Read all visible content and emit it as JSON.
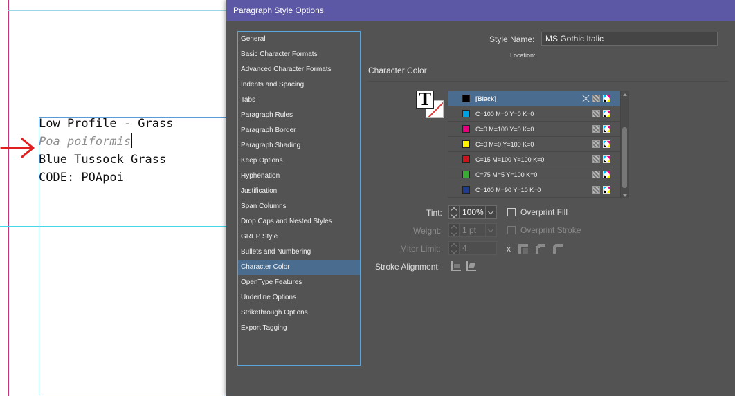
{
  "document": {
    "lines": [
      "Low Profile - Grass",
      "Poa poiformis",
      "Blue Tussock Grass",
      "CODE: POApoi"
    ]
  },
  "dialog": {
    "title": "Paragraph Style Options",
    "nav": {
      "selected": "Character Color",
      "items": [
        "General",
        "Basic Character Formats",
        "Advanced Character Formats",
        "Indents and Spacing",
        "Tabs",
        "Paragraph Rules",
        "Paragraph Border",
        "Paragraph Shading",
        "Keep Options",
        "Hyphenation",
        "Justification",
        "Span Columns",
        "Drop Caps and Nested Styles",
        "GREP Style",
        "Bullets and Numbering",
        "Character Color",
        "OpenType Features",
        "Underline Options",
        "Strikethrough Options",
        "Export Tagging"
      ]
    },
    "style_name_label": "Style Name:",
    "style_name_value": "MS Gothic Italic",
    "location_label": "Location:",
    "section_title": "Character Color",
    "fill_stroke_glyph": "T",
    "swatches": [
      {
        "name": "[Black]",
        "color": "#000000",
        "selected": true
      },
      {
        "name": "C=100 M=0 Y=0 K=0",
        "color": "#00a0e3",
        "selected": false
      },
      {
        "name": "C=0 M=100 Y=0 K=0",
        "color": "#e4007f",
        "selected": false
      },
      {
        "name": "C=0 M=0 Y=100 K=0",
        "color": "#fff100",
        "selected": false
      },
      {
        "name": "C=15 M=100 Y=100 K=0",
        "color": "#c8161e",
        "selected": false
      },
      {
        "name": "C=75 M=5 Y=100 K=0",
        "color": "#3aa935",
        "selected": false
      },
      {
        "name": "C=100 M=90 Y=10 K=0",
        "color": "#1f3b8c",
        "selected": false
      }
    ],
    "tint_label": "Tint:",
    "tint_value": "100%",
    "overprint_fill_label": "Overprint Fill",
    "weight_label": "Weight:",
    "weight_value": "1 pt",
    "overprint_stroke_label": "Overprint Stroke",
    "miter_limit_label": "Miter Limit:",
    "miter_limit_value": "4",
    "miter_x": "x",
    "stroke_alignment_label": "Stroke Alignment:"
  },
  "colors": {
    "titlebar": "#5c58a6",
    "dialog_bg": "#535353",
    "nav_selected": "#4a6d8f",
    "focus_border": "#58a6dc",
    "annotation_arrow": "#e02020"
  }
}
